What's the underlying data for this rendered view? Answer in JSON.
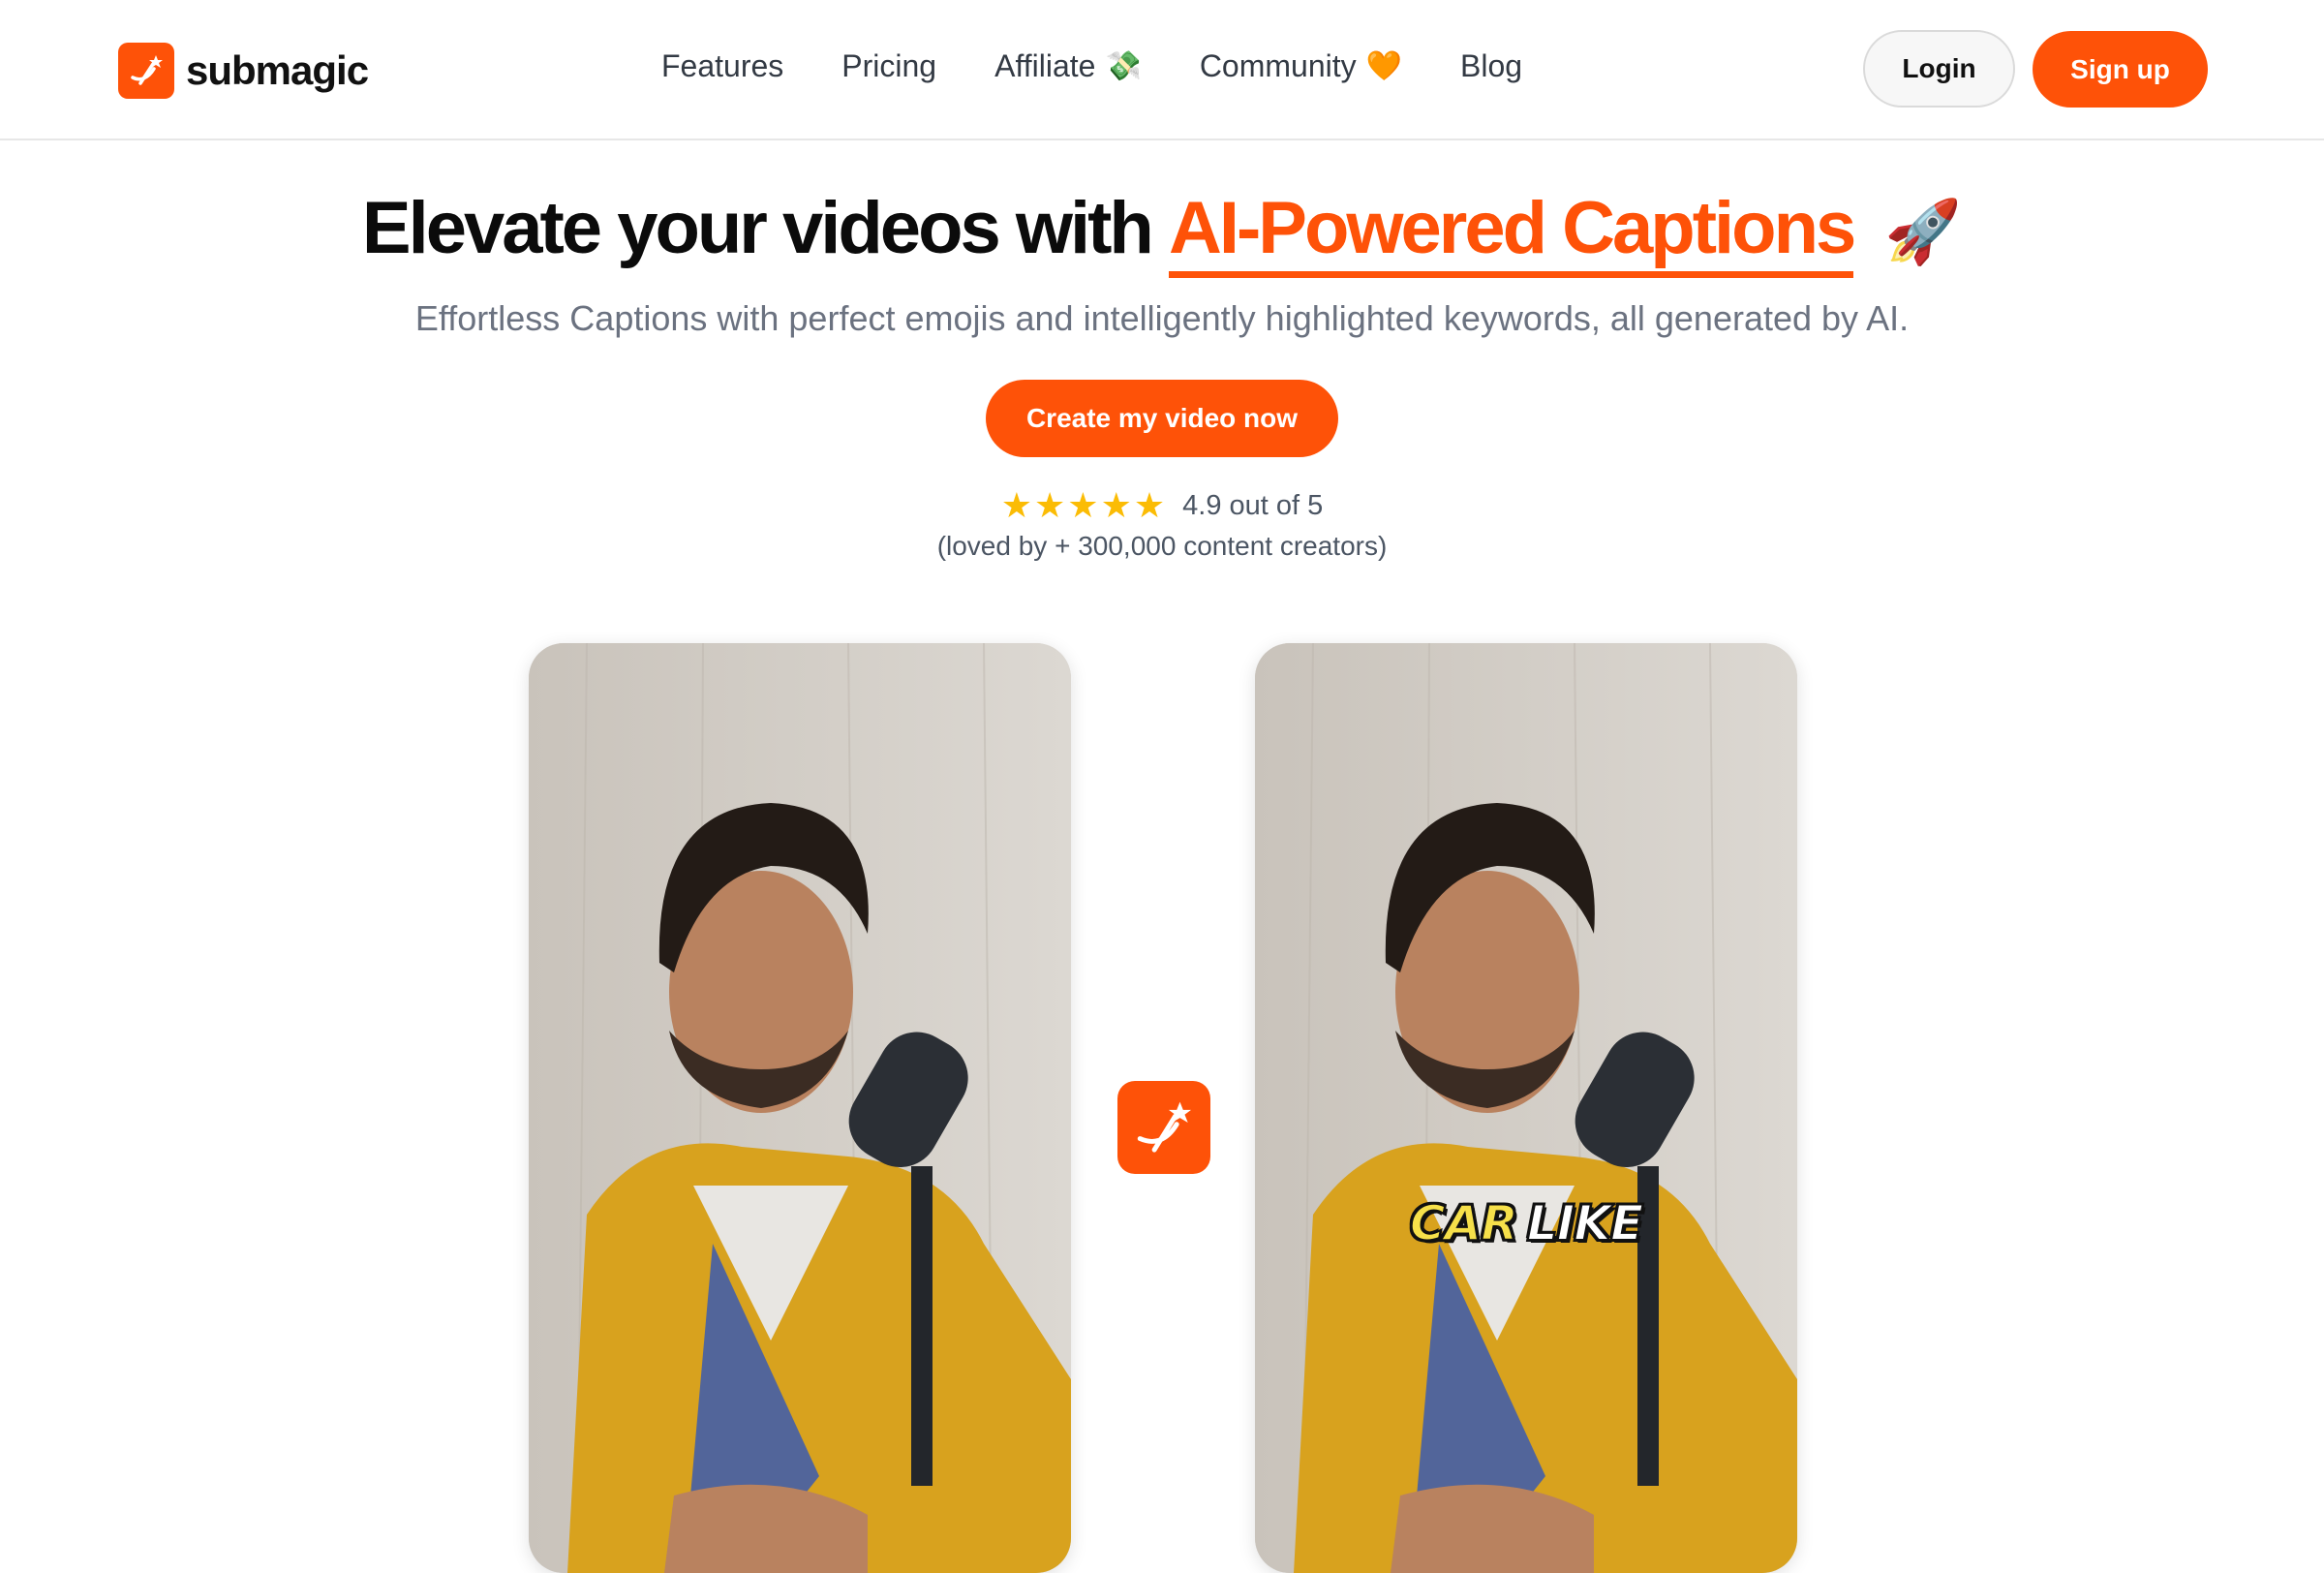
{
  "brand": {
    "name": "submagic",
    "color": "#fe5208"
  },
  "nav": {
    "items": [
      {
        "label": "Features",
        "emoji": ""
      },
      {
        "label": "Pricing",
        "emoji": ""
      },
      {
        "label": "Affiliate",
        "emoji": "💸"
      },
      {
        "label": "Community",
        "emoji": "🧡"
      },
      {
        "label": "Blog",
        "emoji": ""
      }
    ],
    "login_label": "Login",
    "signup_label": "Sign up"
  },
  "hero": {
    "title_prefix": "Elevate your videos with",
    "title_accent": "AI-Powered Captions",
    "title_emoji": "🚀",
    "subtitle": "Effortless Captions with perfect emojis and intelligently highlighted keywords, all generated by AI.",
    "cta_label": "Create my video now",
    "rating_stars": 5,
    "rating_text": "4.9 out of 5",
    "loved_text": "(loved by + 300,000 content creators)"
  },
  "videos": {
    "caption_word_1": "CAR",
    "caption_word_2": "LIKE"
  }
}
